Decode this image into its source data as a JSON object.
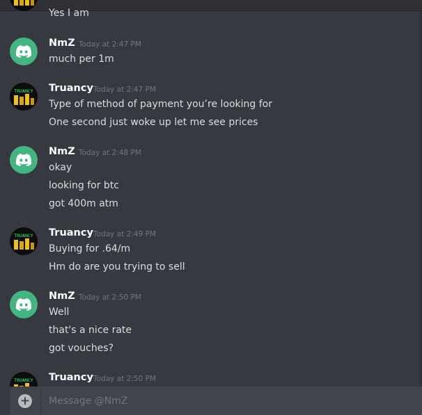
{
  "top_partial": {
    "line": "Yes I am"
  },
  "messages": [
    {
      "author": "NmZ",
      "timestamp": "Today at 2:47 PM",
      "avatar": "discord-logo",
      "lines": [
        "much per 1m"
      ]
    },
    {
      "author": "Truancy",
      "timestamp": "Today at 2:47 PM",
      "avatar": "truancy-gold-coins",
      "lines": [
        "Type of method of payment you’re looking for",
        "One second just woke up let me see prices"
      ]
    },
    {
      "author": "NmZ",
      "timestamp": "Today at 2:48 PM",
      "avatar": "discord-logo",
      "lines": [
        "okay",
        "looking for btc",
        "got 400m atm"
      ]
    },
    {
      "author": "Truancy",
      "timestamp": "Today at 2:49 PM",
      "avatar": "truancy-gold-coins",
      "lines": [
        "Buying for .64/m",
        "Hm do are you trying to sell"
      ]
    },
    {
      "author": "NmZ",
      "timestamp": "Today at 2:50 PM",
      "avatar": "discord-logo",
      "lines": [
        "Well",
        "that's a nice rate",
        "got vouches?"
      ]
    },
    {
      "author": "Truancy",
      "timestamp": "Today at 2:50 PM",
      "avatar": "truancy-gold-coins",
      "lines": []
    }
  ],
  "avatar_text": "TRUANCY",
  "composer": {
    "placeholder": "Message @NmZ",
    "attach_icon": "plus-circle-icon"
  },
  "colors": {
    "background": "#36393f",
    "composer": "#40444b",
    "discord_green": "#43b581",
    "truancy_green": "#2dff6e",
    "gold": "#e6c21a"
  }
}
